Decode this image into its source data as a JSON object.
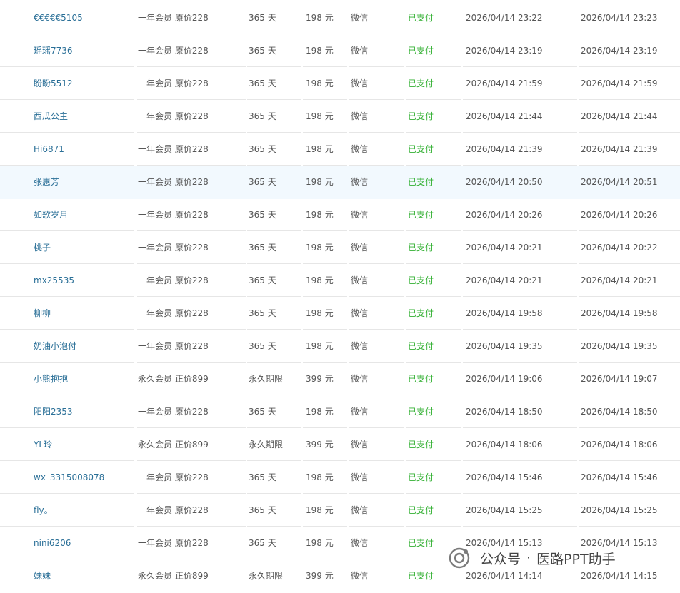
{
  "rows": [
    {
      "user": "€€€€€5105",
      "plan": "一年会员 原价228",
      "duration": "365 天",
      "price": "198 元",
      "method": "微信",
      "status": "已支付",
      "created": "2026/04/14 23:22",
      "paid": "2026/04/14 23:23"
    },
    {
      "user": "瑶瑶7736",
      "plan": "一年会员 原价228",
      "duration": "365 天",
      "price": "198 元",
      "method": "微信",
      "status": "已支付",
      "created": "2026/04/14 23:19",
      "paid": "2026/04/14 23:19"
    },
    {
      "user": "盼盼5512",
      "plan": "一年会员 原价228",
      "duration": "365 天",
      "price": "198 元",
      "method": "微信",
      "status": "已支付",
      "created": "2026/04/14 21:59",
      "paid": "2026/04/14 21:59"
    },
    {
      "user": "西瓜公主",
      "plan": "一年会员 原价228",
      "duration": "365 天",
      "price": "198 元",
      "method": "微信",
      "status": "已支付",
      "created": "2026/04/14 21:44",
      "paid": "2026/04/14 21:44"
    },
    {
      "user": "Hi6871",
      "plan": "一年会员 原价228",
      "duration": "365 天",
      "price": "198 元",
      "method": "微信",
      "status": "已支付",
      "created": "2026/04/14 21:39",
      "paid": "2026/04/14 21:39"
    },
    {
      "user": "张惠芳",
      "plan": "一年会员 原价228",
      "duration": "365 天",
      "price": "198 元",
      "method": "微信",
      "status": "已支付",
      "created": "2026/04/14 20:50",
      "paid": "2026/04/14 20:51"
    },
    {
      "user": "如歌岁月",
      "plan": "一年会员 原价228",
      "duration": "365 天",
      "price": "198 元",
      "method": "微信",
      "status": "已支付",
      "created": "2026/04/14 20:26",
      "paid": "2026/04/14 20:26"
    },
    {
      "user": "桃子",
      "plan": "一年会员 原价228",
      "duration": "365 天",
      "price": "198 元",
      "method": "微信",
      "status": "已支付",
      "created": "2026/04/14 20:21",
      "paid": "2026/04/14 20:22"
    },
    {
      "user": "mx25535",
      "plan": "一年会员 原价228",
      "duration": "365 天",
      "price": "198 元",
      "method": "微信",
      "status": "已支付",
      "created": "2026/04/14 20:21",
      "paid": "2026/04/14 20:21"
    },
    {
      "user": "柳柳",
      "plan": "一年会员 原价228",
      "duration": "365 天",
      "price": "198 元",
      "method": "微信",
      "status": "已支付",
      "created": "2026/04/14 19:58",
      "paid": "2026/04/14 19:58"
    },
    {
      "user": "奶油小泡付",
      "plan": "一年会员 原价228",
      "duration": "365 天",
      "price": "198 元",
      "method": "微信",
      "status": "已支付",
      "created": "2026/04/14 19:35",
      "paid": "2026/04/14 19:35"
    },
    {
      "user": "小熊抱抱",
      "plan": "永久会员 正价899",
      "duration": "永久期限",
      "price": "399 元",
      "method": "微信",
      "status": "已支付",
      "created": "2026/04/14 19:06",
      "paid": "2026/04/14 19:07"
    },
    {
      "user": "阳阳2353",
      "plan": "一年会员 原价228",
      "duration": "365 天",
      "price": "198 元",
      "method": "微信",
      "status": "已支付",
      "created": "2026/04/14 18:50",
      "paid": "2026/04/14 18:50"
    },
    {
      "user": "YL玲",
      "plan": "永久会员 正价899",
      "duration": "永久期限",
      "price": "399 元",
      "method": "微信",
      "status": "已支付",
      "created": "2026/04/14 18:06",
      "paid": "2026/04/14 18:06"
    },
    {
      "user": "wx_3315008078",
      "plan": "一年会员 原价228",
      "duration": "365 天",
      "price": "198 元",
      "method": "微信",
      "status": "已支付",
      "created": "2026/04/14 15:46",
      "paid": "2026/04/14 15:46"
    },
    {
      "user": "fly。",
      "plan": "一年会员 原价228",
      "duration": "365 天",
      "price": "198 元",
      "method": "微信",
      "status": "已支付",
      "created": "2026/04/14 15:25",
      "paid": "2026/04/14 15:25"
    },
    {
      "user": "nini6206",
      "plan": "一年会员 原价228",
      "duration": "365 天",
      "price": "198 元",
      "method": "微信",
      "status": "已支付",
      "created": "2026/04/14 15:13",
      "paid": "2026/04/14 15:13"
    },
    {
      "user": "妹妹",
      "plan": "永久会员 正价899",
      "duration": "永久期限",
      "price": "399 元",
      "method": "微信",
      "status": "已支付",
      "created": "2026/04/14 14:14",
      "paid": "2026/04/14 14:15"
    }
  ],
  "highlighted_row": 5,
  "watermark": {
    "icon": "wechat-official-account-icon",
    "prefix": "公众号",
    "separator": "·",
    "name": "医路PPT助手"
  },
  "colors": {
    "user_link": "#2a6f97",
    "status_paid": "#33b033",
    "row_highlight": "#f2f9fe",
    "row_border": "#e6e6e6"
  }
}
